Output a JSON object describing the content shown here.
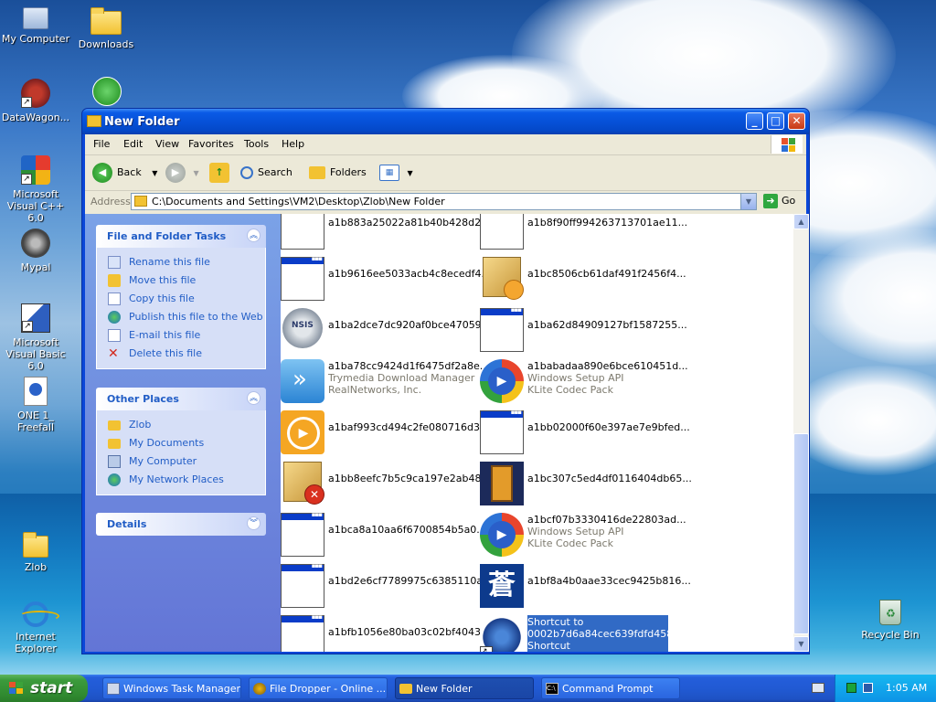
{
  "desktop": {
    "icons": [
      {
        "label": "My Computer"
      },
      {
        "label": "Downloads"
      },
      {
        "label": "DataWagon..."
      },
      {
        "label": "Microsoft Visual C++ 6.0"
      },
      {
        "label": "Mypal"
      },
      {
        "label": "Microsoft Visual Basic 6.0"
      },
      {
        "label": "ONE 1_ Freefall"
      },
      {
        "label": "Zlob"
      },
      {
        "label": "Internet Explorer"
      },
      {
        "label": "Recycle Bin"
      }
    ]
  },
  "window": {
    "title": "New Folder",
    "menu": [
      "File",
      "Edit",
      "View",
      "Favorites",
      "Tools",
      "Help"
    ],
    "toolbar": {
      "back": "Back",
      "search": "Search",
      "folders": "Folders"
    },
    "address": {
      "label": "Address",
      "path": "C:\\Documents and Settings\\VM2\\Desktop\\Zlob\\New Folder",
      "go": "Go"
    },
    "file_tasks": {
      "title": "File and Folder Tasks",
      "items": [
        "Rename this file",
        "Move this file",
        "Copy this file",
        "Publish this file to the Web",
        "E-mail this file",
        "Delete this file"
      ]
    },
    "other_places": {
      "title": "Other Places",
      "items": [
        "Zlob",
        "My Documents",
        "My Computer",
        "My Network Places"
      ]
    },
    "details": {
      "title": "Details"
    },
    "files": [
      {
        "name": "a1b883a25022a81b40b428d2..."
      },
      {
        "name": "a1b8f90ff994263713701ae11..."
      },
      {
        "name": "a1b9616ee5033acb4c8ecedf4..."
      },
      {
        "name": "a1bc8506cb61daf491f2456f4..."
      },
      {
        "name": "a1ba2dce7dc920af0bce47059..."
      },
      {
        "name": "a1ba62d84909127bf1587255..."
      },
      {
        "name": "a1ba78cc9424d1f6475df2a8e...",
        "line2": "Trymedia Download Manager",
        "line3": "RealNetworks, Inc."
      },
      {
        "name": "a1babadaa890e6bce610451d...",
        "line2": "Windows Setup API",
        "line3": "KLite Codec Pack"
      },
      {
        "name": "a1baf993cd494c2fe080716d3..."
      },
      {
        "name": "a1bb02000f60e397ae7e9bfed..."
      },
      {
        "name": "a1bb8eefc7b5c9ca197e2ab48..."
      },
      {
        "name": "a1bc307c5ed4df0116404db65..."
      },
      {
        "name": "a1bca8a10aa6f6700854b5a0..."
      },
      {
        "name": "a1bcf07b3330416de22803ad...",
        "line2": "Windows Setup API",
        "line3": "KLite Codec Pack"
      },
      {
        "name": "a1bd2e6cf7789975c6385110a..."
      },
      {
        "name": "a1bf8a4b0aae33cec9425b816..."
      },
      {
        "name": "a1bfb1056e80ba03c02bf4043..."
      },
      {
        "name": "Shortcut to",
        "line2": "0002b7d6a84cec639fdfd458f...",
        "line3": "Shortcut"
      }
    ]
  },
  "taskbar": {
    "start": "start",
    "tasks": [
      "Windows Task Manager",
      "File Dropper - Online ...",
      "New Folder",
      "Command Prompt"
    ],
    "clock": "1:05 AM"
  }
}
